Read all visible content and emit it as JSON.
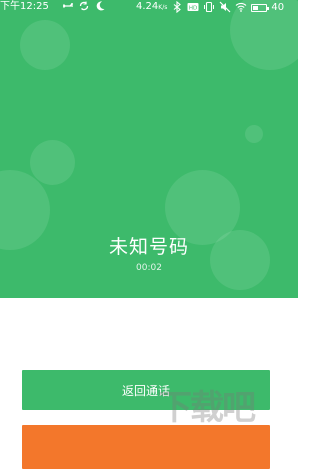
{
  "status_bar": {
    "time": "下午12:25",
    "network_speed": "4.24",
    "network_speed_unit": "K/s",
    "battery_level": "40",
    "battery_fraction": 0.4,
    "left_icons": [
      "usb-icon",
      "sync-icon",
      "moon-icon"
    ],
    "right_icons": [
      "bluetooth-icon",
      "hd-icon",
      "vibrate-icon",
      "mute-icon",
      "wifi-icon",
      "battery-icon"
    ]
  },
  "call": {
    "caller_name": "未知号码",
    "duration": "00:02"
  },
  "actions": {
    "return_label": "返回通话",
    "hangup_label": ""
  },
  "colors": {
    "hero_bg": "#3dba6b",
    "return_button_bg": "#3dba6b",
    "hangup_button_bg": "#f3772b"
  }
}
